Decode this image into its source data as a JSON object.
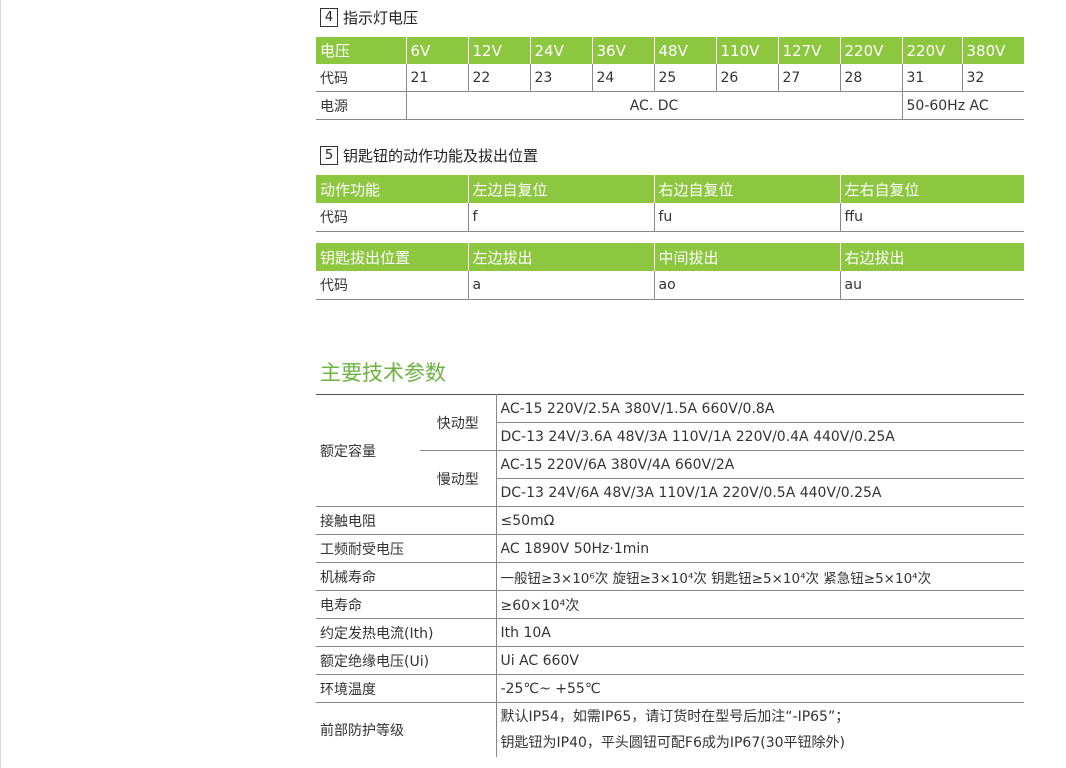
{
  "section4": {
    "num": "4",
    "title": "指示灯电压",
    "header": [
      "电压",
      "6V",
      "12V",
      "24V",
      "36V",
      "48V",
      "110V",
      "127V",
      "220V",
      "220V",
      "380V"
    ],
    "codes": [
      "代码",
      "21",
      "22",
      "23",
      "24",
      "25",
      "26",
      "27",
      "28",
      "31",
      "32"
    ],
    "power_label": "电源",
    "power_acdc": "AC. DC",
    "power_ac": "50-60Hz AC",
    "header_color": "#8dc63f"
  },
  "section5": {
    "num": "5",
    "title": "钥匙钮的动作功能及拔出位置",
    "action_header": [
      "动作功能",
      "左边自复位",
      "右边自复位",
      "左右自复位"
    ],
    "action_codes": [
      "代码",
      "f",
      "fu",
      "ffu"
    ],
    "pull_header": [
      "钥匙拔出位置",
      "左边拔出",
      "中间拔出",
      "右边拔出"
    ],
    "pull_codes": [
      "代码",
      "a",
      "ao",
      "au"
    ]
  },
  "specs": {
    "heading": "主要技术参数",
    "heading_color": "#6cb33f",
    "rated_capacity": "额定容量",
    "fast_type": "快动型",
    "slow_type": "慢动型",
    "fast_ac": "AC-15 220V/2.5A 380V/1.5A 660V/0.8A",
    "fast_dc": "DC-13 24V/3.6A 48V/3A 110V/1A 220V/0.4A 440V/0.25A",
    "slow_ac": "AC-15 220V/6A 380V/4A 660V/2A",
    "slow_dc": "DC-13 24V/6A 48V/3A 110V/1A 220V/0.5A 440V/0.25A",
    "rows": [
      {
        "label": "接触电阻",
        "value": "≤50mΩ"
      },
      {
        "label": "工频耐受电压",
        "value": "AC 1890V  50Hz·1min"
      },
      {
        "label": "机械寿命",
        "value": "一般钮≥3×10⁶次  旋钮≥3×10⁴次  钥匙钮≥5×10⁴次  紧急钮≥5×10⁴次"
      },
      {
        "label": "电寿命",
        "value": "≥60×10⁴次"
      },
      {
        "label": "约定发热电流(Ith)",
        "value": "Ith 10A"
      },
      {
        "label": "额定绝缘电压(Ui)",
        "value": "Ui AC 660V"
      },
      {
        "label": "环境温度",
        "value": "-25℃~ +55℃"
      }
    ],
    "protection_label": "前部防护等级",
    "protection_line1": "默认IP54，如需IP65，请订货时在型号后加注“-IP65”；",
    "protection_line2": "钥匙钮为IP40，平头圆钮可配F6成为IP67(30平钮除外)"
  }
}
